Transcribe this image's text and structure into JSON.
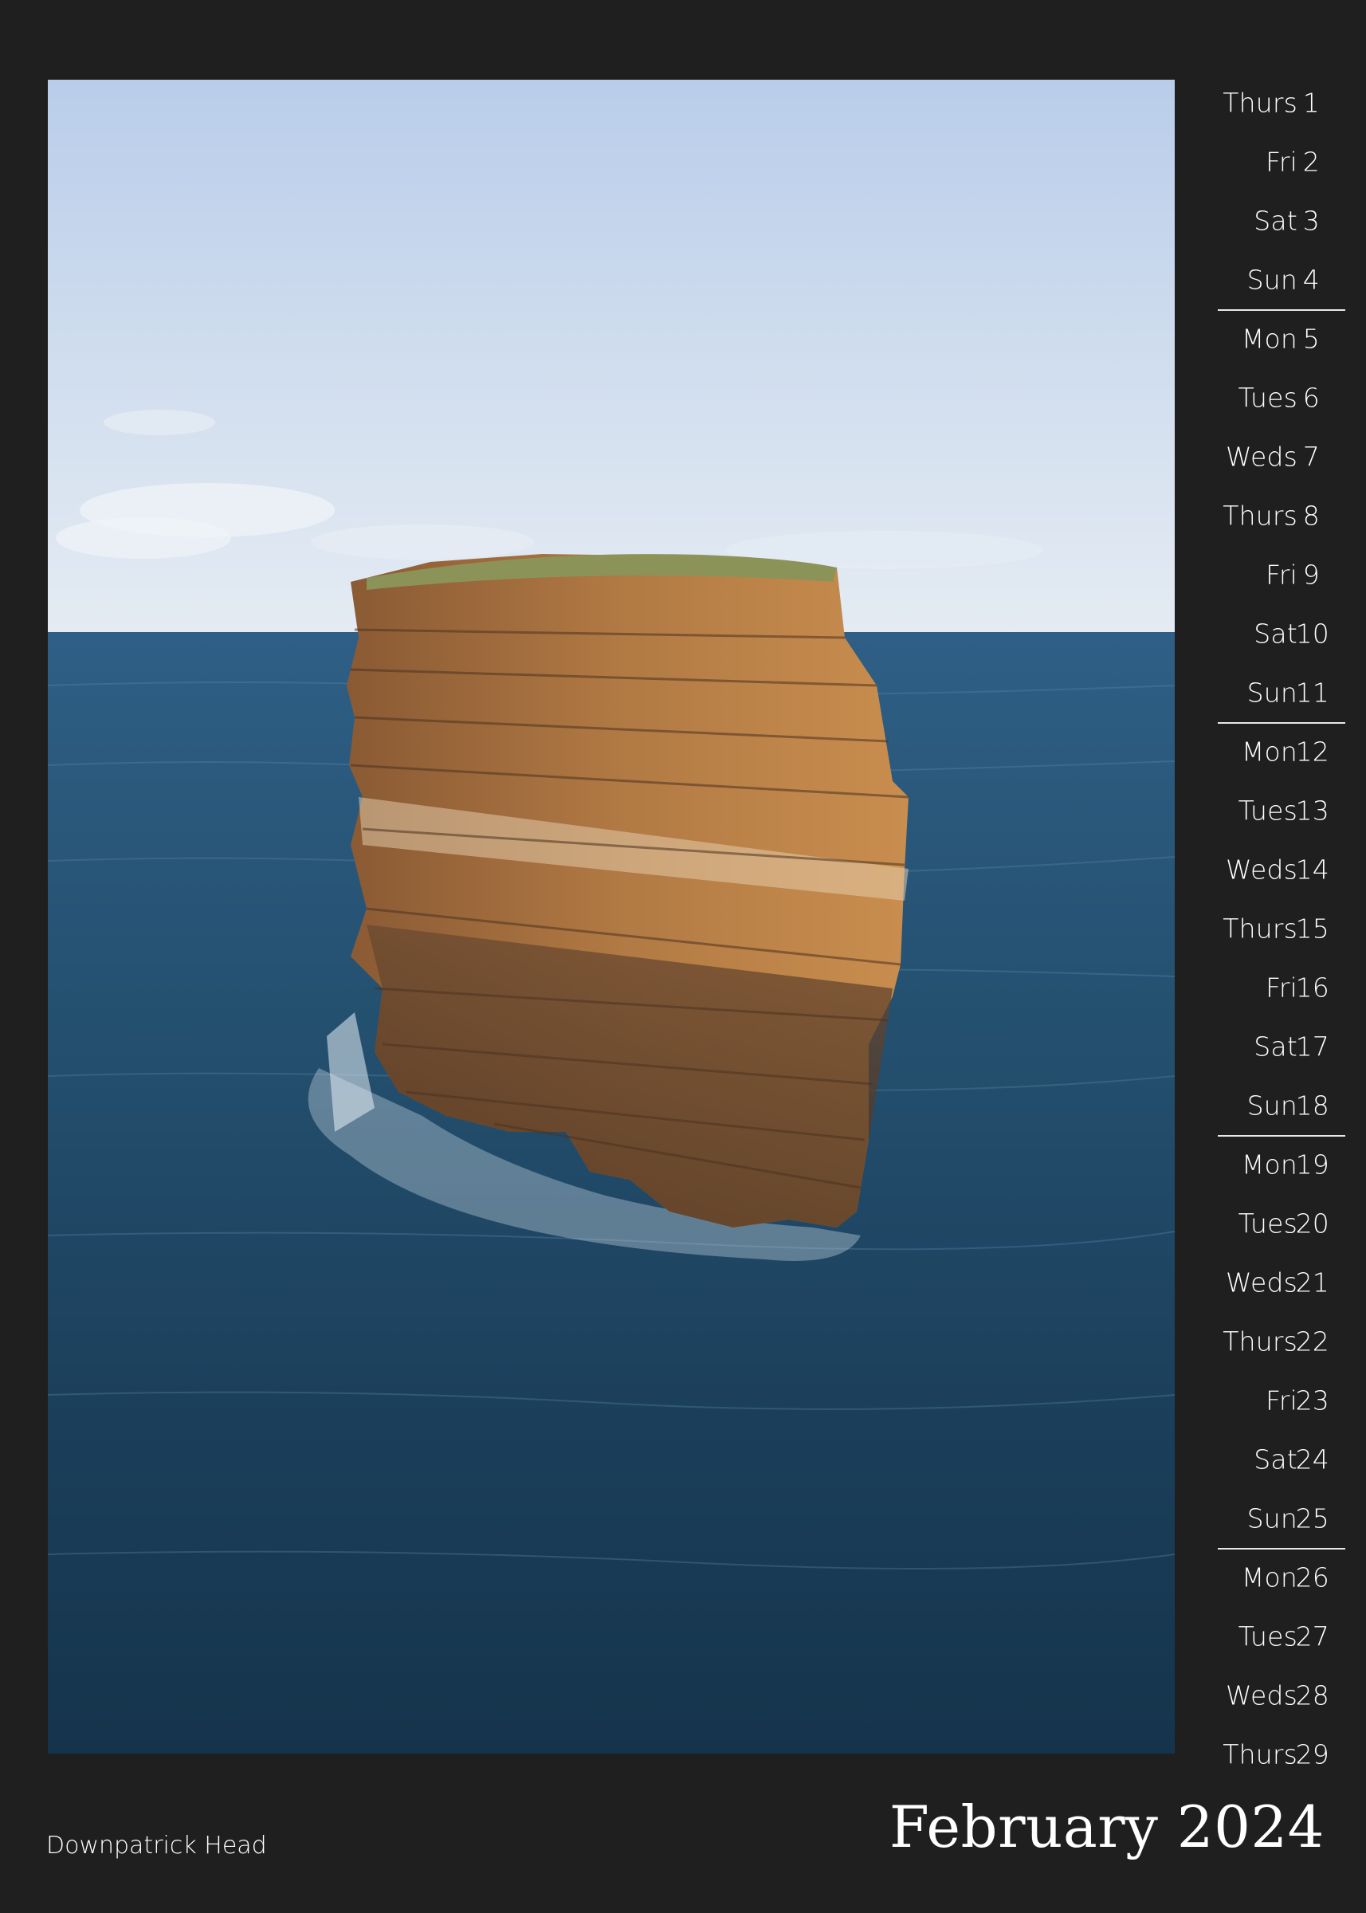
{
  "colors": {
    "background": "#1f1f1f",
    "text": "#ffffff",
    "separator": "#e8e8e8"
  },
  "calendar": {
    "days": [
      {
        "name": "Thurs",
        "num": "1"
      },
      {
        "name": "Fri",
        "num": "2"
      },
      {
        "name": "Sat",
        "num": "3"
      },
      {
        "name": "Sun",
        "num": "4",
        "week_end": true
      },
      {
        "name": "Mon",
        "num": "5"
      },
      {
        "name": "Tues",
        "num": "6"
      },
      {
        "name": "Weds",
        "num": "7"
      },
      {
        "name": "Thurs",
        "num": "8"
      },
      {
        "name": "Fri",
        "num": "9"
      },
      {
        "name": "Sat",
        "num": "10"
      },
      {
        "name": "Sun",
        "num": "11",
        "week_end": true
      },
      {
        "name": "Mon",
        "num": "12"
      },
      {
        "name": "Tues",
        "num": "13"
      },
      {
        "name": "Weds",
        "num": "14"
      },
      {
        "name": "Thurs",
        "num": "15"
      },
      {
        "name": "Fri",
        "num": "16"
      },
      {
        "name": "Sat",
        "num": "17"
      },
      {
        "name": "Sun",
        "num": "18",
        "week_end": true
      },
      {
        "name": "Mon",
        "num": "19"
      },
      {
        "name": "Tues",
        "num": "20"
      },
      {
        "name": "Weds",
        "num": "21"
      },
      {
        "name": "Thurs",
        "num": "22"
      },
      {
        "name": "Fri",
        "num": "23"
      },
      {
        "name": "Sat",
        "num": "24"
      },
      {
        "name": "Sun",
        "num": "25",
        "week_end": true
      },
      {
        "name": "Mon",
        "num": "26"
      },
      {
        "name": "Tues",
        "num": "27"
      },
      {
        "name": "Weds",
        "num": "28"
      },
      {
        "name": "Thurs",
        "num": "29"
      }
    ]
  },
  "caption": "Downpatrick Head",
  "month_title": "February 2024"
}
